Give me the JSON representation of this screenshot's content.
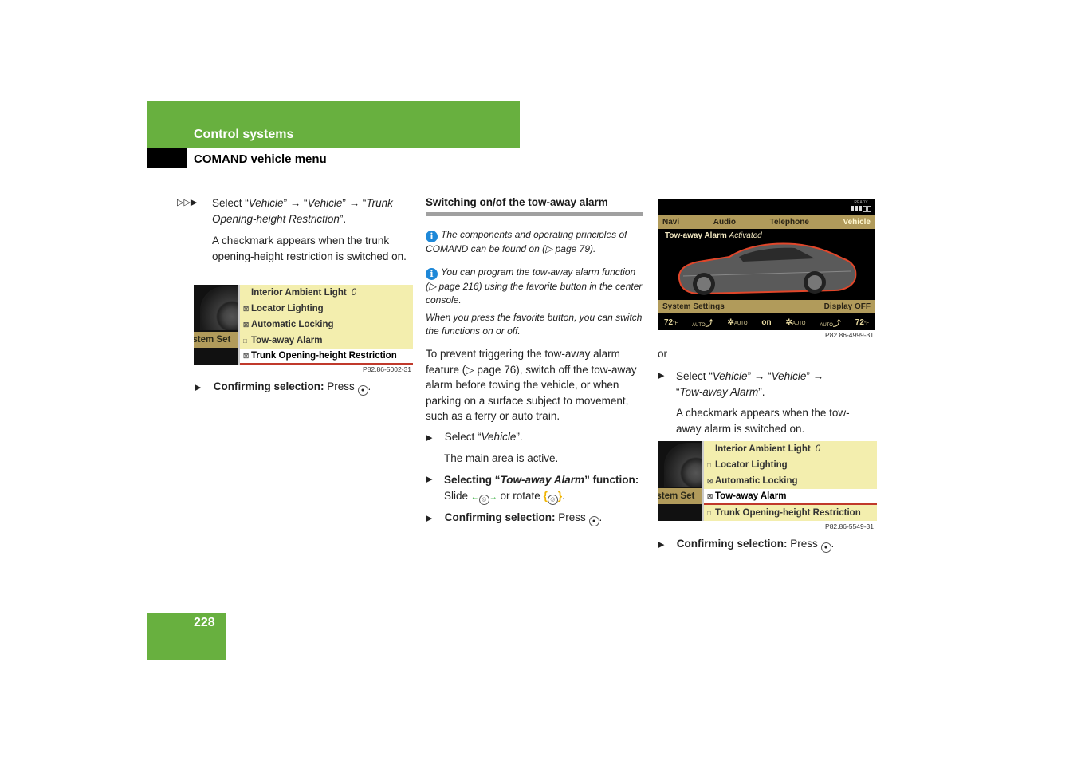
{
  "header": {
    "section_title": "Control systems",
    "subsection_title": "COMAND vehicle menu"
  },
  "page_number": "228",
  "col1": {
    "continued_marker": "▷▷▶",
    "step1": {
      "prefix": "Select “",
      "p1": "Vehicle",
      "mid1": "” → “",
      "p2": "Vehicle",
      "mid2": "” → “",
      "p3": "Trunk Opening-height Restriction",
      "suffix": "”."
    },
    "step1_result": "A checkmark appears when the trunk opening-height restriction is switched on.",
    "menu_image": {
      "left_label": "ystem Set",
      "rows": [
        {
          "checkbox": "",
          "label": "Interior Ambient Light",
          "value": "0",
          "selected": false
        },
        {
          "checkbox": "☒",
          "label": "Locator Lighting",
          "selected": false
        },
        {
          "checkbox": "☒",
          "label": "Automatic Locking",
          "selected": false
        },
        {
          "checkbox": "□",
          "label": "Tow-away Alarm",
          "selected": false
        },
        {
          "checkbox": "☒",
          "label": "Trunk Opening-height Restriction",
          "selected": true
        }
      ],
      "caption": "P82.86-5002-31"
    },
    "confirm": {
      "bold": "Confirming selection:",
      "text": " Press ",
      "icon": "press-controller-icon",
      "end": "."
    }
  },
  "col2": {
    "title": "Switching on/of the tow-away alarm",
    "note1": "The components and operating principles of COMAND can be found on (▷ page 79).",
    "note2": "You can program the tow-away alarm function (▷ page 216) using the favorite button in the center console.",
    "note3": "When you press the favorite button, you can switch the functions on or off.",
    "para": "To prevent triggering the tow-away alarm feature (▷ page 76), switch off the tow-away alarm before towing the vehicle, or when parking on a surface subject to movement, such as a ferry or auto train.",
    "step1": {
      "prefix": "Select “",
      "italic": "Vehicle",
      "suffix": "”."
    },
    "step1_result": "The main area is active.",
    "step2": {
      "bold1": "Selecting “",
      "bold_italic": "Tow-away Alarm",
      "bold2": "” function:",
      "text1": " Slide ",
      "text2": " or rotate ",
      "end": "."
    },
    "step3": {
      "bold": "Confirming selection:",
      "text": " Press ",
      "end": "."
    }
  },
  "col3": {
    "screen": {
      "ready_label": "READY",
      "ready_level": "3/5",
      "nav": [
        "Navi",
        "Audio",
        "Telephone",
        "Vehicle"
      ],
      "active_nav": "Vehicle",
      "status_label": "Tow-away Alarm",
      "status_value": "Activated",
      "bottom_left": "System Settings",
      "bottom_right": "Display OFF",
      "climate": {
        "left_temp": "72",
        "unit": "°F",
        "auto1": "AUTO",
        "fan_auto1": "AUTO",
        "center": "on",
        "fan_auto2": "AUTO",
        "auto2": "AUTO",
        "right_temp": "72"
      },
      "caption": "P82.86-4999-31"
    },
    "or": "or",
    "step1": {
      "prefix": "Select “",
      "p1": "Vehicle",
      "mid1": "” → “",
      "p2": "Vehicle",
      "mid2": "” → “",
      "p3": "Tow-away Alarm",
      "suffix": "”."
    },
    "step1_result": "A checkmark appears when the tow-away alarm is switched on.",
    "menu_image": {
      "left_label": "ystem Set",
      "rows": [
        {
          "checkbox": "",
          "label": "Interior Ambient Light",
          "value": "0",
          "selected": false
        },
        {
          "checkbox": "□",
          "label": "Locator Lighting",
          "selected": false
        },
        {
          "checkbox": "☒",
          "label": "Automatic Locking",
          "selected": false
        },
        {
          "checkbox": "☒",
          "label": "Tow-away Alarm",
          "selected": true
        },
        {
          "checkbox": "□",
          "label": "Trunk Opening-height Restriction",
          "selected": false
        }
      ],
      "caption": "P82.86-5549-31"
    },
    "confirm": {
      "bold": "Confirming selection:",
      "text": " Press ",
      "end": "."
    }
  }
}
